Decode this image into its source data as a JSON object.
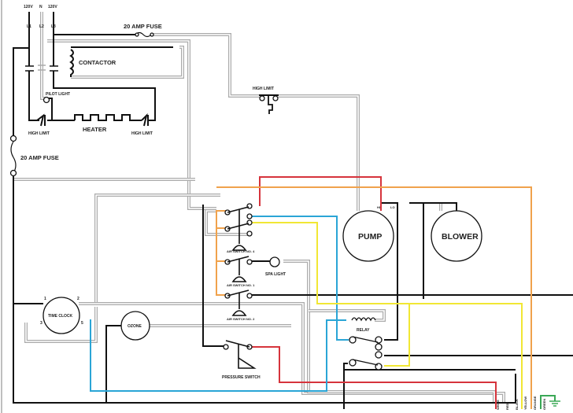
{
  "supply": {
    "l1_voltage": "120V",
    "neutral": "N",
    "l3_voltage": "120V",
    "l1": "L1",
    "l2": "L2",
    "l3": "L3"
  },
  "labels": {
    "fuse_top": "20 AMP FUSE",
    "fuse_left": "20 AMP FUSE",
    "contactor": "CONTACTOR",
    "pilot_light": "PILOT LIGHT",
    "high_limit_left": "HIGH LIMIT",
    "heater": "HEATER",
    "high_limit_right": "HIGH LIMIT",
    "high_limit_top": "HIGH LIMIT",
    "pump": "PUMP",
    "pump_hi": "HI",
    "pump_lo": "LO",
    "blower": "BLOWER",
    "air_switch_4": "AIR SWITCH NO. 4",
    "air_switch_1": "AIR SWITCH NO. 1",
    "air_switch_2": "AIR SWITCH NO. 2",
    "spa_light": "SPA LIGHT",
    "time_clock": "TIME CLOCK",
    "tc_pin1": "1",
    "tc_pin2": "2",
    "tc_pin3": "3",
    "tc_pin5": "5",
    "ozone": "OZONE",
    "relay": "RELAY",
    "pressure_switch": "PRESSURE SWITCH"
  },
  "wire_legend": [
    "WHITE",
    "RED",
    "BLACK",
    "YELLOW",
    "ORANGE",
    "GREEN"
  ],
  "colors": {
    "red": "#d6343c",
    "blue": "#2aa5d6",
    "yellow": "#f1e734",
    "orange": "#f0a24c",
    "green": "#3aa856",
    "neutral_gray": "#aaaaaa",
    "black": "#111111"
  }
}
